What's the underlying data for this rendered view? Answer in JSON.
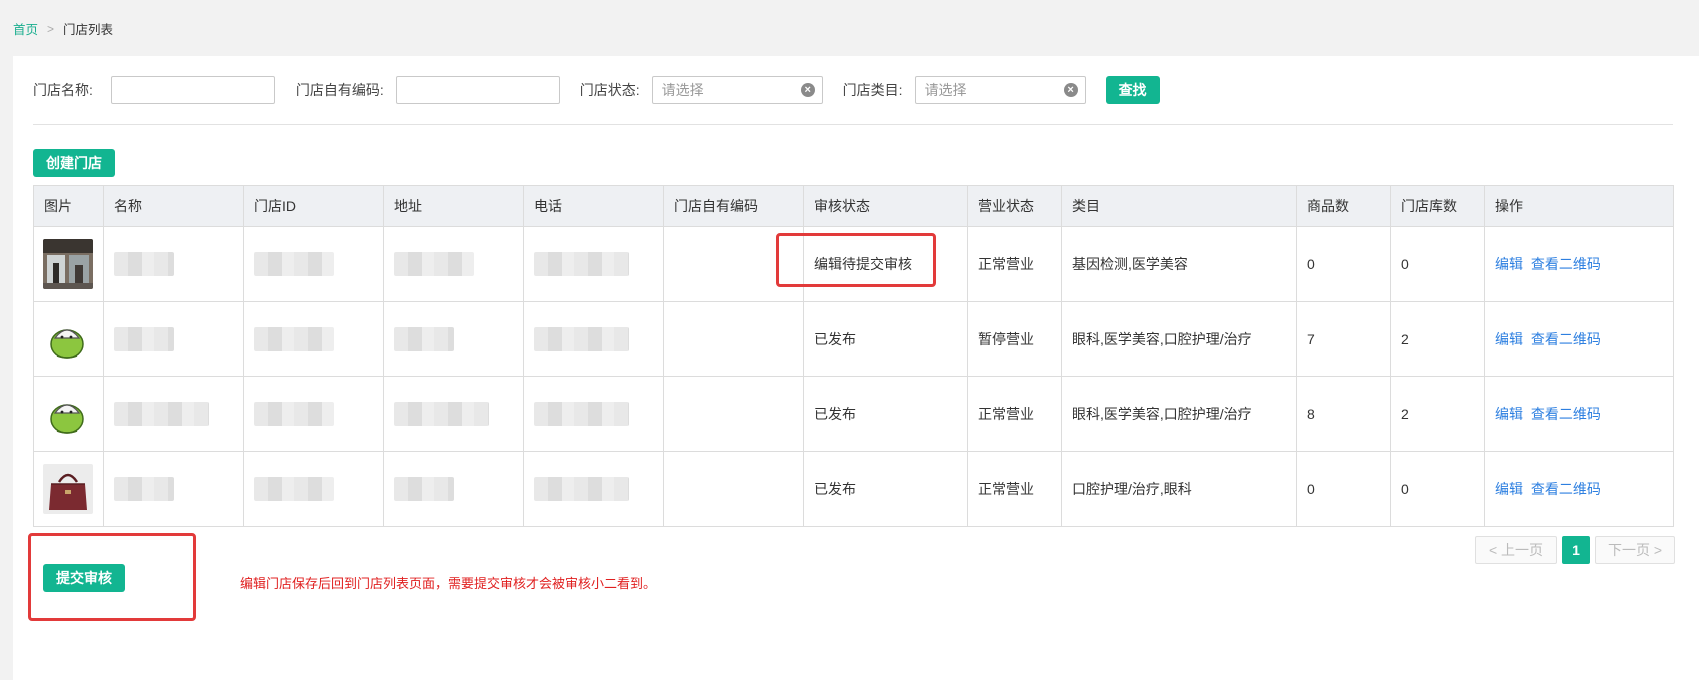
{
  "breadcrumb": {
    "home": "首页",
    "sep": ">",
    "current": "门店列表"
  },
  "filters": {
    "store_name_label": "门店名称:",
    "own_code_label": "门店自有编码:",
    "status_label": "门店状态:",
    "status_placeholder": "请选择",
    "category_label": "门店类目:",
    "category_placeholder": "请选择",
    "search_button": "查找"
  },
  "toolbar": {
    "create_button": "创建门店"
  },
  "table": {
    "headers": [
      "图片",
      "名称",
      "门店ID",
      "地址",
      "电话",
      "门店自有编码",
      "审核状态",
      "营业状态",
      "类目",
      "商品数",
      "门店库数",
      "操作"
    ],
    "rows": [
      {
        "image": "storefront-photo",
        "audit": "编辑待提交审核",
        "business": "正常营业",
        "category": "基因检测,医学美容",
        "goods": "0",
        "stock": "0",
        "edit": "编辑",
        "qr": "查看二维码"
      },
      {
        "image": "dumpling-mascot",
        "audit": "已发布",
        "business": "暂停营业",
        "category": "眼科,医学美容,口腔护理/治疗",
        "goods": "7",
        "stock": "2",
        "edit": "编辑",
        "qr": "查看二维码"
      },
      {
        "image": "dumpling-mascot",
        "audit": "已发布",
        "business": "正常营业",
        "category": "眼科,医学美容,口腔护理/治疗",
        "goods": "8",
        "stock": "2",
        "edit": "编辑",
        "qr": "查看二维码"
      },
      {
        "image": "handbag-photo",
        "audit": "已发布",
        "business": "正常营业",
        "category": "口腔护理/治疗,眼科",
        "goods": "0",
        "stock": "0",
        "edit": "编辑",
        "qr": "查看二维码"
      }
    ]
  },
  "pagination": {
    "prev": "上一页",
    "current": "1",
    "next": "下一页"
  },
  "footer": {
    "submit_button": "提交审核",
    "notice": "编辑门店保存后回到门店列表页面，需要提交审核才会被审核小二看到。"
  },
  "colors": {
    "accent": "#12b591",
    "link": "#2d7fe0",
    "alert": "#e23a3a"
  }
}
